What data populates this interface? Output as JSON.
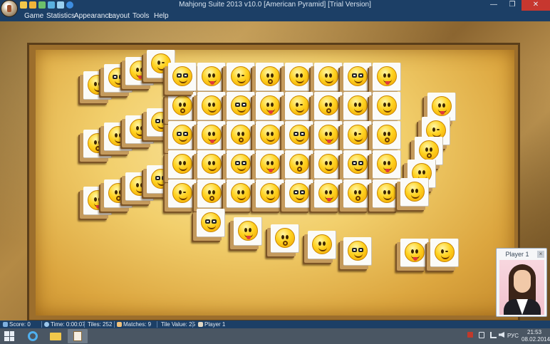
{
  "window": {
    "title": "Mahjong Suite 2013 v10.0  [American Pyramid]  [Trial Version]",
    "minimize": "—",
    "maximize": "❐",
    "close": "✕"
  },
  "menu": [
    "Game",
    "Statistics",
    "Appearance",
    "Layout",
    "Tools",
    "Help"
  ],
  "status": {
    "score": "Score: 0",
    "time": "Time: 0:00:07",
    "tiles": "Tiles: 252",
    "matches": "Matches: 9",
    "tile_value": "Tile Value: 25",
    "player": "Player 1"
  },
  "player_card": {
    "name": "Player 1",
    "close": "×"
  },
  "taskbar": {
    "lang": "РУС",
    "time": "21:53",
    "date": "08.02.2014"
  },
  "colors": {
    "chrome": "#1c3f66",
    "tile_face": "#fbfbf8",
    "smiley": "#ffd21f"
  }
}
